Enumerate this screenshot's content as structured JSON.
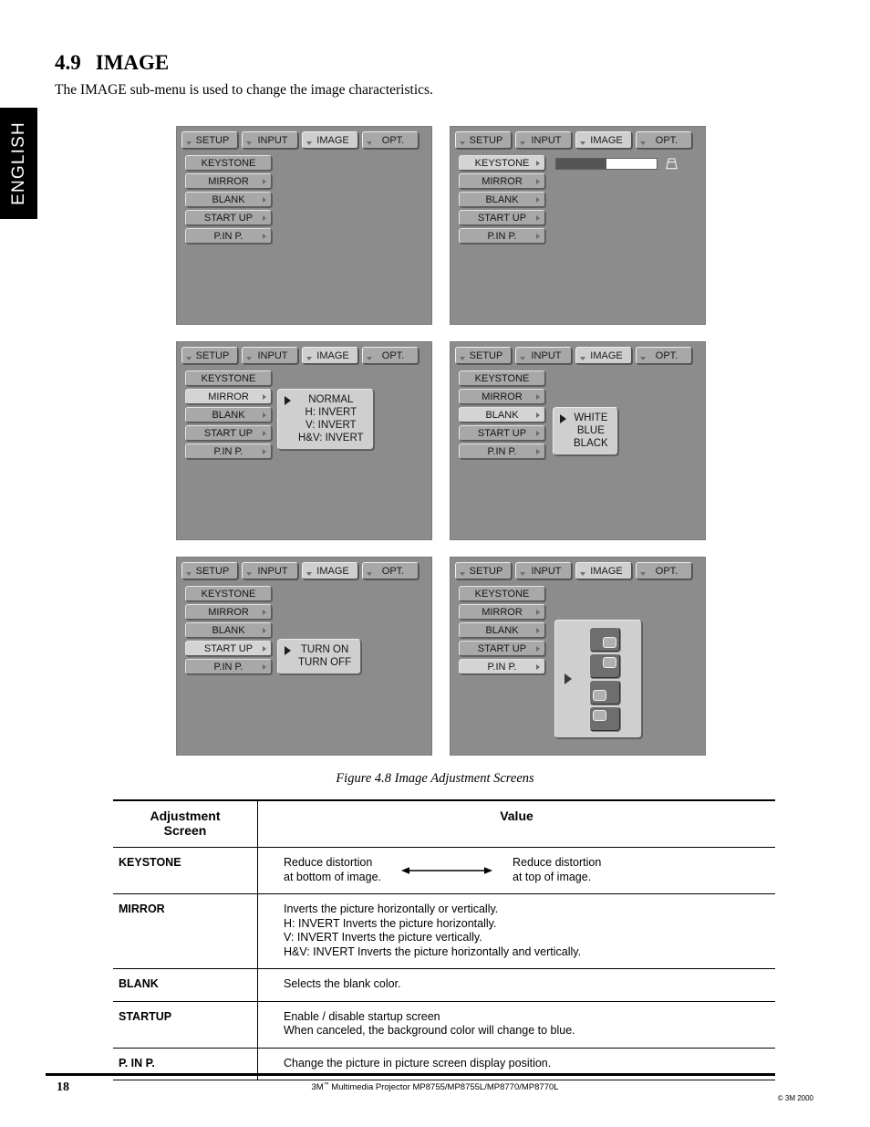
{
  "language_tab": "ENGLISH",
  "section": {
    "number": "4.9",
    "title": "IMAGE",
    "intro": "The IMAGE sub-menu is used to change the image characteristics."
  },
  "osd": {
    "tabs": [
      {
        "label": "SETUP",
        "selected": false
      },
      {
        "label": "INPUT",
        "selected": false
      },
      {
        "label": "IMAGE",
        "selected": true
      },
      {
        "label": "OPT.",
        "selected": false
      }
    ],
    "menu_items": [
      {
        "label": "KEYSTONE"
      },
      {
        "label": "MIRROR"
      },
      {
        "label": "BLANK"
      },
      {
        "label": "START UP"
      },
      {
        "label": "P.IN P."
      }
    ],
    "panels": [
      {
        "name": "base",
        "highlight": null
      },
      {
        "name": "keystone",
        "highlight": "KEYSTONE",
        "slider_fill_percent": 50
      },
      {
        "name": "mirror",
        "highlight": "MIRROR",
        "options": [
          "NORMAL",
          "H: INVERT",
          "V: INVERT",
          "H&V: INVERT"
        ]
      },
      {
        "name": "blank",
        "highlight": "BLANK",
        "options": [
          "WHITE",
          "BLUE",
          "BLACK"
        ]
      },
      {
        "name": "startup",
        "highlight": "START UP",
        "options": [
          "TURN ON",
          "TURN OFF"
        ]
      },
      {
        "name": "pinp",
        "highlight": "P.IN P.",
        "positions": [
          "bottom-right",
          "top-right",
          "bottom-left",
          "top-left"
        ]
      }
    ]
  },
  "figure_caption": "Figure 4.8  Image Adjustment Screens",
  "table": {
    "headers": [
      "Adjustment\nScreen",
      "Value"
    ],
    "header_col1_line1": "Adjustment",
    "header_col1_line2": "Screen",
    "header_col2": "Value",
    "rows": [
      {
        "screen": "KEYSTONE",
        "type": "keystone",
        "left_line1": "Reduce distortion",
        "left_line2": "at bottom of image.",
        "right_line1": "Reduce distortion",
        "right_line2": "at top of image."
      },
      {
        "screen": "MIRROR",
        "type": "text",
        "lines": [
          "Inverts the picture horizontally or vertically.",
          "H:  INVERT Inverts the picture horizontally.",
          "V:  INVERT Inverts the picture vertically.",
          "H&V:  INVERT Inverts the picture horizontally and vertically."
        ]
      },
      {
        "screen": "BLANK",
        "type": "text",
        "lines": [
          "Selects the blank color."
        ]
      },
      {
        "screen": "STARTUP",
        "type": "text",
        "lines": [
          "Enable / disable startup screen",
          "When canceled, the background color will change to blue."
        ]
      },
      {
        "screen": "P. IN P.",
        "type": "text",
        "lines": [
          "Change the picture in picture screen display position."
        ]
      }
    ]
  },
  "footer": {
    "page_number": "18",
    "brand": "3M",
    "trademark": "™",
    "product_line": " Multimedia Projector MP8755/MP8755L/MP8770/MP8770L",
    "copyright": "© 3M 2000"
  },
  "colors": {
    "osd_background": "#8c8c8c",
    "button_face": "#a8a8a8",
    "button_highlight": "#d4d4d4",
    "submenu_face": "#cfcfcf"
  }
}
